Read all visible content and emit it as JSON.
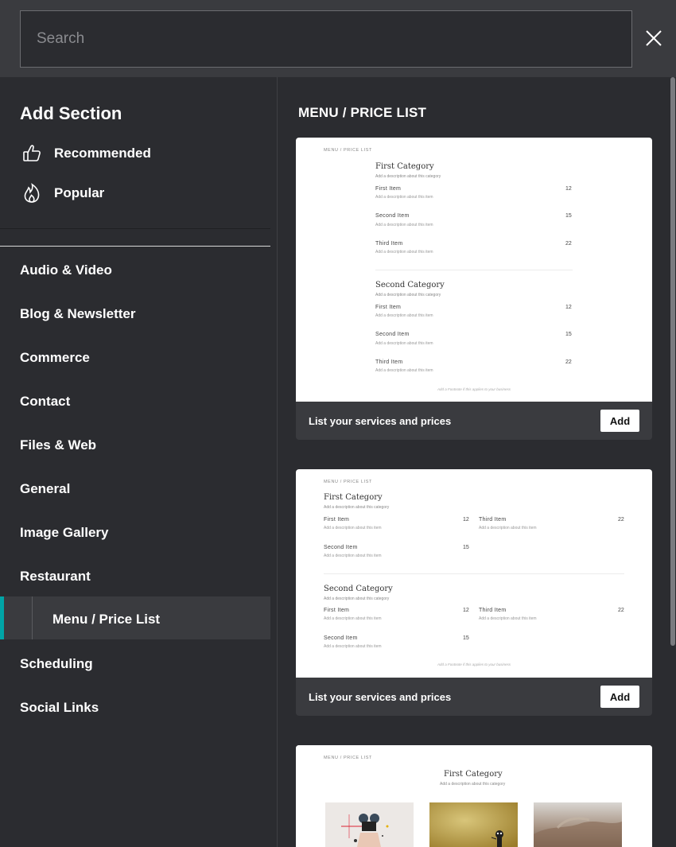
{
  "search": {
    "placeholder": "Search"
  },
  "sidebar": {
    "title": "Add Section",
    "quick": [
      {
        "label": "Recommended",
        "icon": "thumbs-up-icon"
      },
      {
        "label": "Popular",
        "icon": "flame-icon"
      }
    ],
    "categories": [
      "Audio & Video",
      "Blog & Newsletter",
      "Commerce",
      "Contact",
      "Files & Web",
      "General",
      "Image Gallery",
      "Restaurant",
      "Scheduling",
      "Social Links"
    ],
    "active_sub": "Menu / Price List"
  },
  "main": {
    "title": "MENU / PRICE LIST",
    "card_desc": "List your services and prices",
    "add_label": "Add"
  },
  "preview": {
    "tag": "MENU / PRICE LIST",
    "cat1": "First Category",
    "cat2": "Second Category",
    "cat_desc": "Add a description about this category",
    "item1": "First Item",
    "item2": "Second Item",
    "item3": "Third Item",
    "item_desc": "Add a description about this item",
    "price1": "12",
    "price2": "15",
    "price3": "22",
    "footnote": "Add a Footnote if this applies to your business"
  },
  "colors": {
    "accent": "#00a4a6",
    "panel": "#2b2c30",
    "header": "#3a3b3f"
  }
}
